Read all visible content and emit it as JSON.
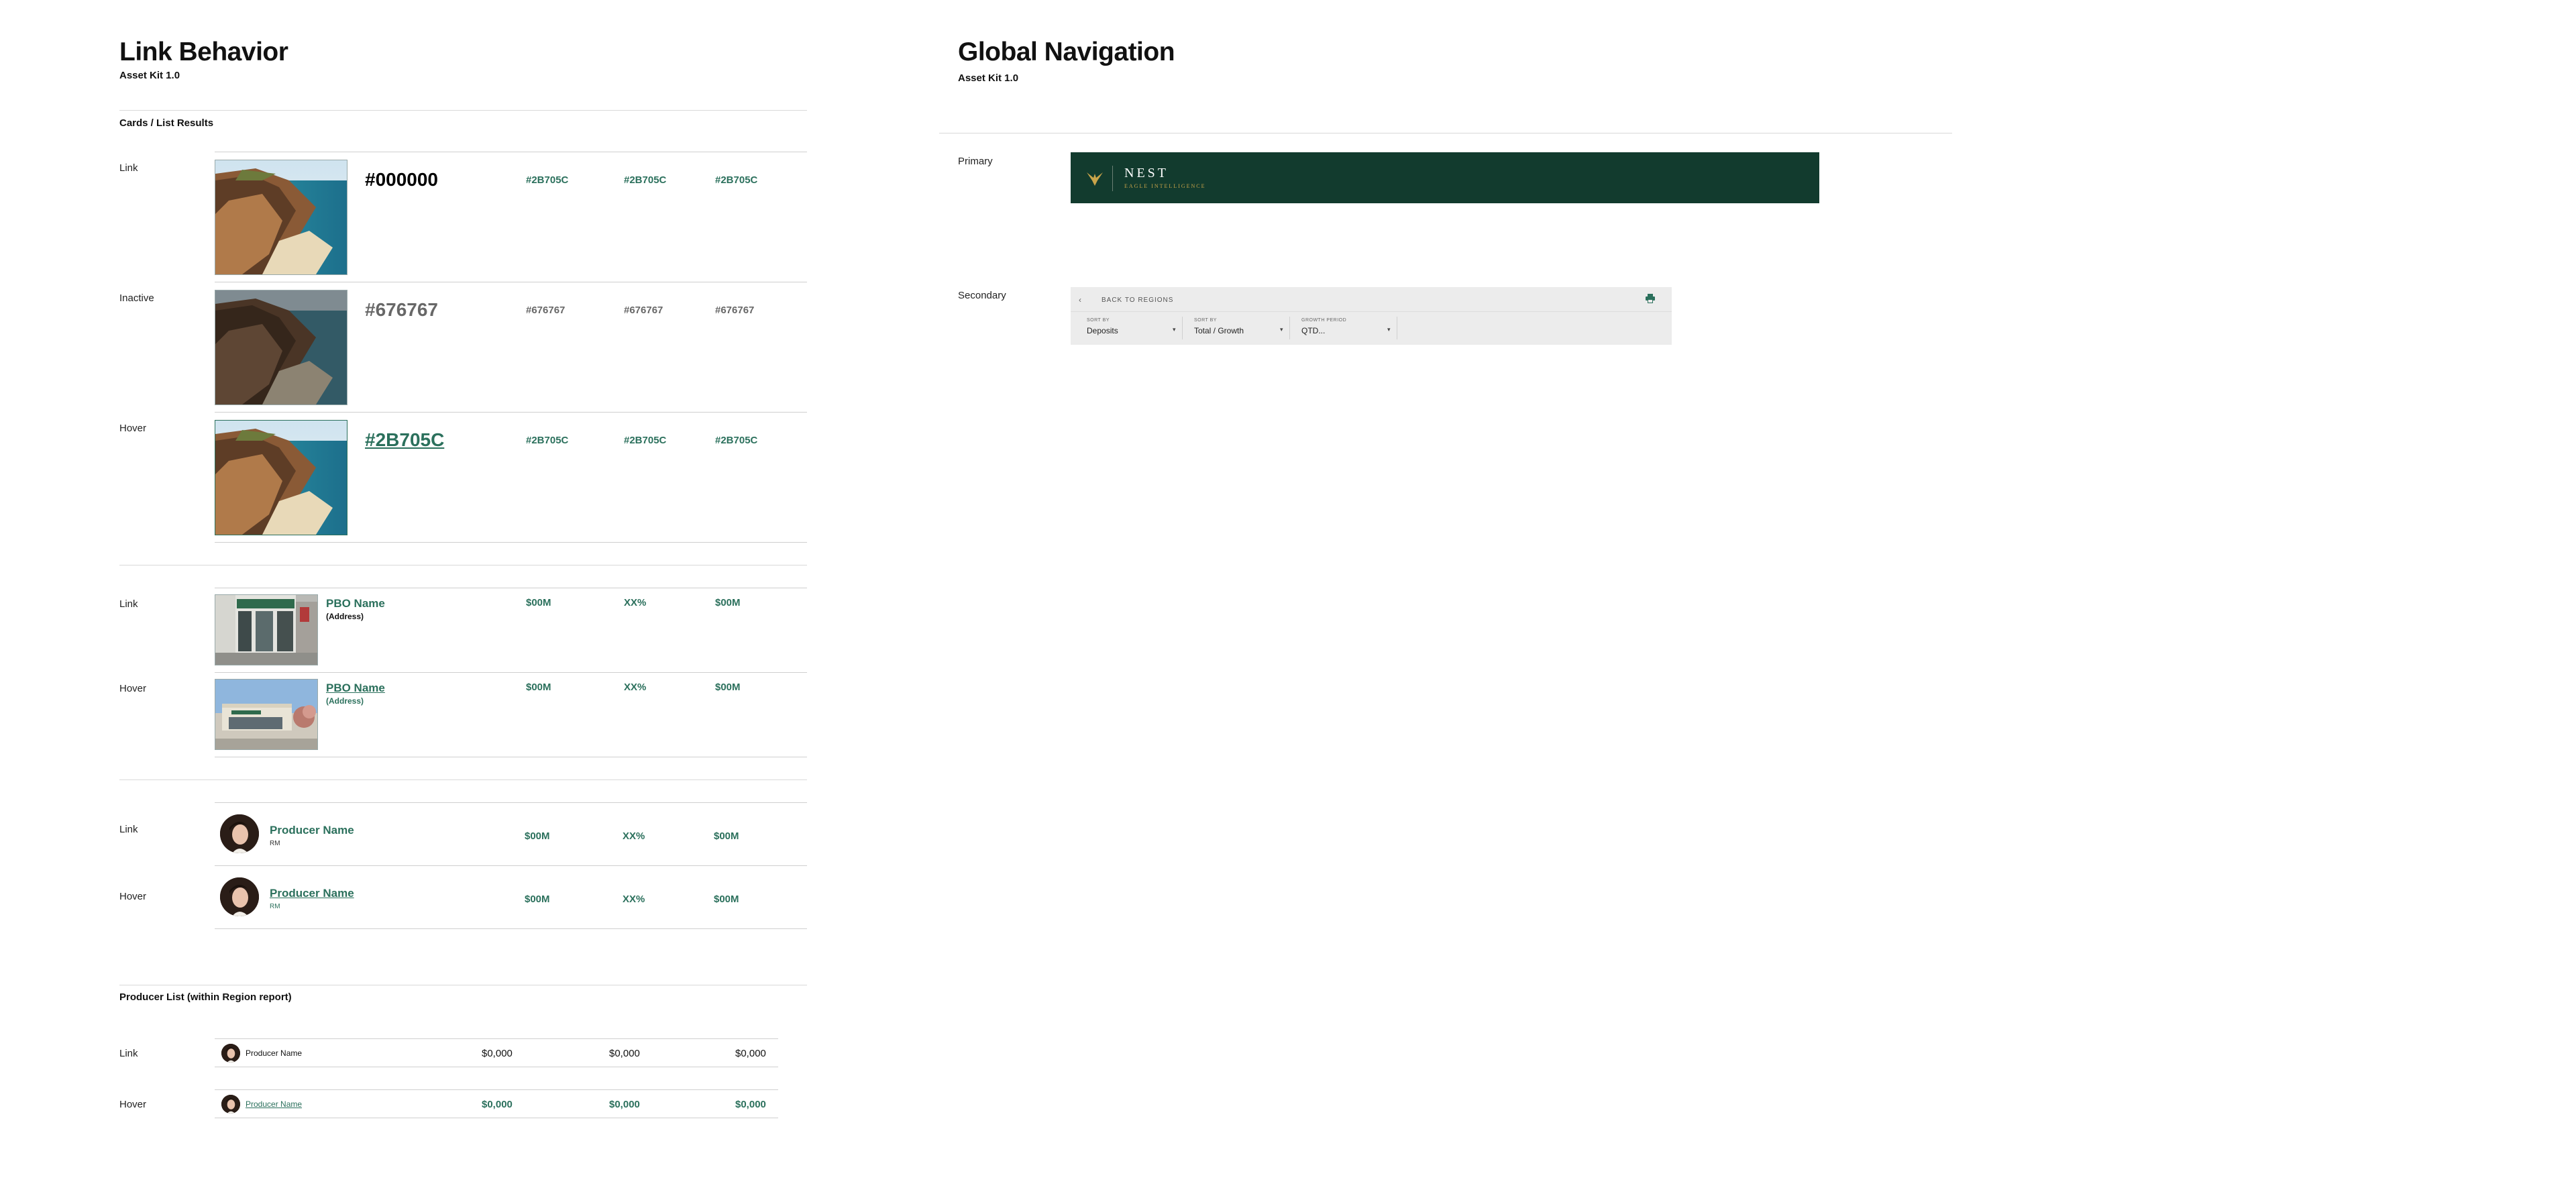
{
  "left": {
    "title": "Link Behavior",
    "subtitle": "Asset Kit 1.0",
    "section_cards": "Cards / List Results",
    "cards": [
      {
        "label": "Link",
        "name": "#000000",
        "cols": [
          "#2B705C",
          "#2B705C",
          "#2B705C"
        ]
      },
      {
        "label": "Inactive",
        "name": "#676767",
        "cols": [
          "#676767",
          "#676767",
          "#676767"
        ]
      },
      {
        "label": "Hover",
        "name": "#2B705C",
        "cols": [
          "#2B705C",
          "#2B705C",
          "#2B705C"
        ]
      }
    ],
    "pbo": [
      {
        "label": "Link",
        "name": "PBO Name",
        "address": "(Address)",
        "cols": [
          "$00M",
          "XX%",
          "$00M"
        ]
      },
      {
        "label": "Hover",
        "name": "PBO Name",
        "address": "(Address)",
        "cols": [
          "$00M",
          "XX%",
          "$00M"
        ]
      }
    ],
    "producers": [
      {
        "label": "Link",
        "name": "Producer Name",
        "role": "RM",
        "cols": [
          "$00M",
          "XX%",
          "$00M"
        ]
      },
      {
        "label": "Hover",
        "name": "Producer Name",
        "role": "RM",
        "cols": [
          "$00M",
          "XX%",
          "$00M"
        ]
      }
    ],
    "section_producer_list": "Producer List (within Region report)",
    "producer_list": [
      {
        "label": "Link",
        "name": "Producer Name",
        "cols": [
          "$0,000",
          "$0,000",
          "$0,000"
        ]
      },
      {
        "label": "Hover",
        "name": "Producer Name",
        "cols": [
          "$0,000",
          "$0,000",
          "$0,000"
        ]
      }
    ]
  },
  "right": {
    "title": "Global Navigation",
    "subtitle": "Asset Kit 1.0",
    "primary_label": "Primary",
    "secondary_label": "Secondary",
    "primary_nav": {
      "brand": "NEST",
      "tagline": "EAGLE INTELLIGENCE",
      "logo_icon": "eagle-icon"
    },
    "secondary_nav": {
      "back_label": "BACK TO REGIONS",
      "back_icon": "chevron-left-icon",
      "print_icon": "print-icon",
      "dropdowns": [
        {
          "caption": "SORT BY",
          "value": "Deposits"
        },
        {
          "caption": "SORT BY",
          "value": "Total / Growth"
        },
        {
          "caption": "GROWTH PERIOD",
          "value": "QTD..."
        }
      ]
    }
  },
  "colors": {
    "link_green": "#2B705C",
    "inactive_grey": "#676767",
    "primary_nav_bg": "#123b2e",
    "accent_gold": "#c9a44a"
  }
}
